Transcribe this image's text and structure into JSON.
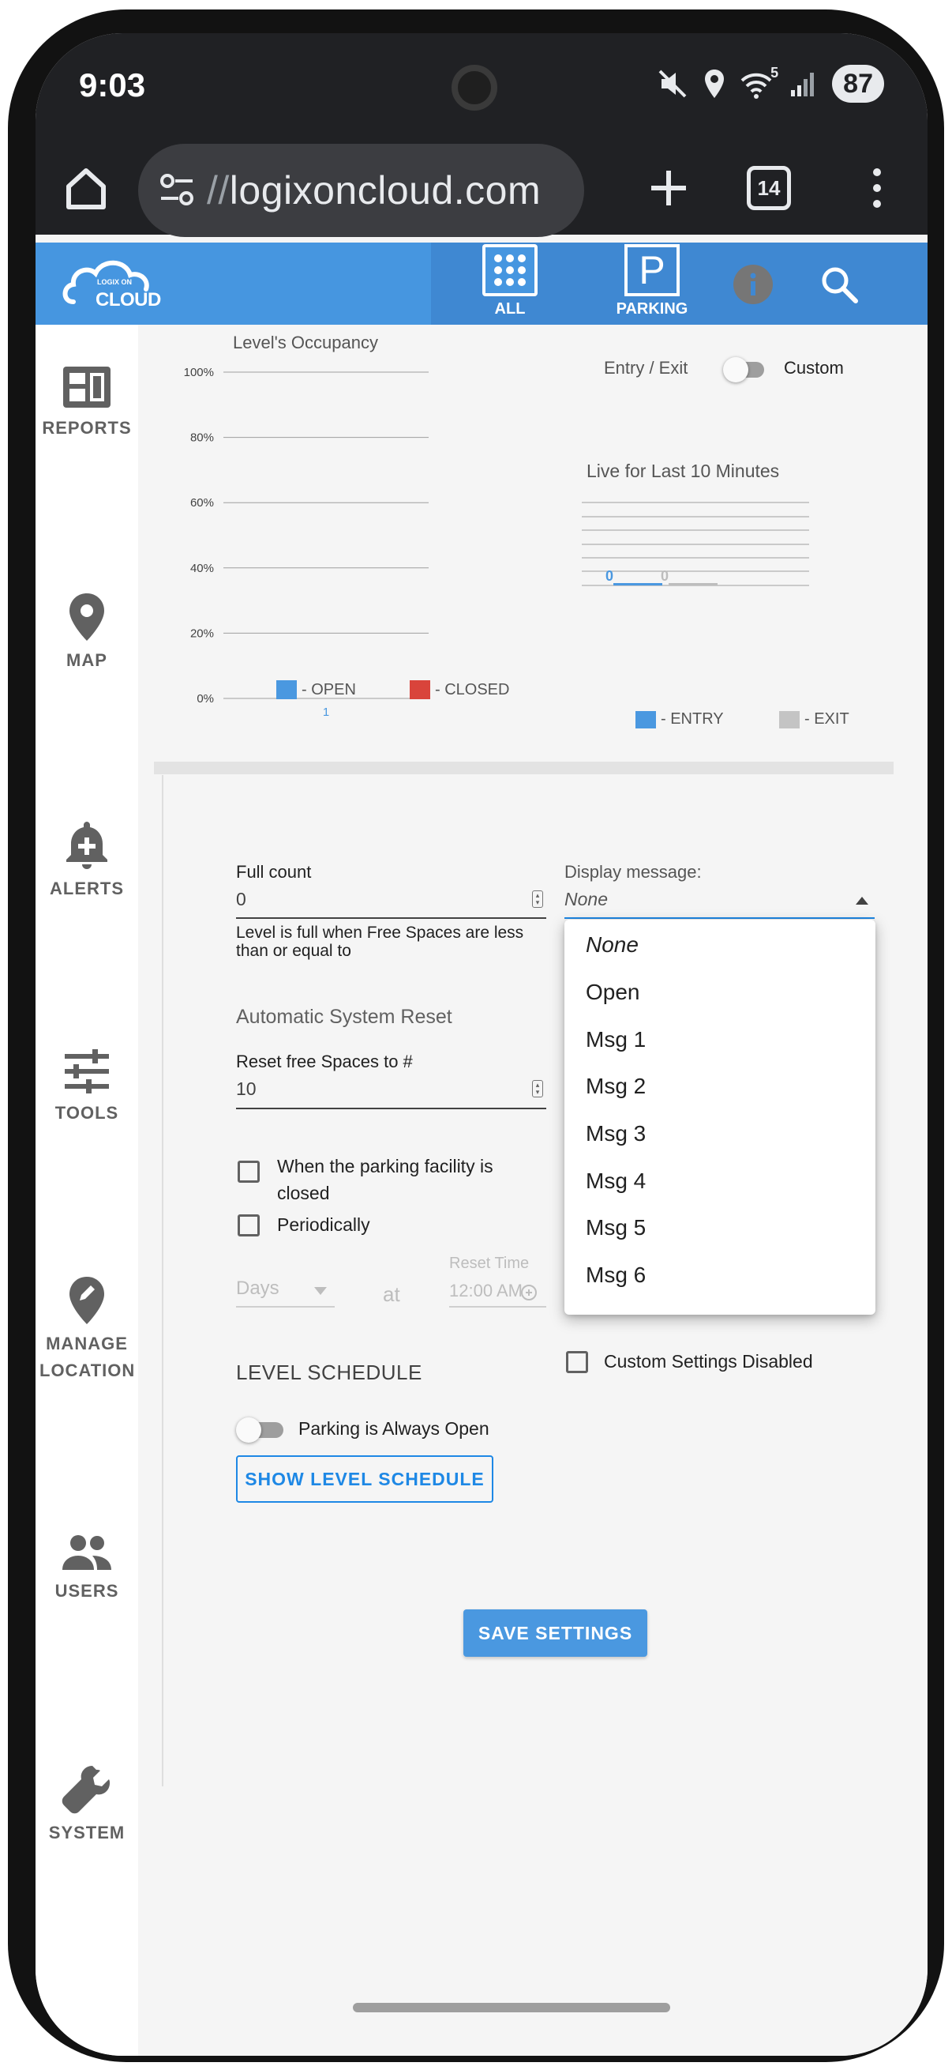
{
  "status_bar": {
    "time": "9:03",
    "battery": "87",
    "wifi_level": "5"
  },
  "browser": {
    "url_prefix": "//",
    "url_domain": "logixoncloud.com",
    "tab_count": "14"
  },
  "header": {
    "logo_small": "LOGIX ON",
    "logo_big": "CLOUD",
    "nav": [
      {
        "label": "ALL"
      },
      {
        "label": "PARKING"
      }
    ]
  },
  "sidebar": {
    "items": [
      {
        "label": "REPORTS"
      },
      {
        "label": "MAP"
      },
      {
        "label": "ALERTS"
      },
      {
        "label": "TOOLS"
      },
      {
        "label": "MANAGE LOCATION"
      },
      {
        "label": "USERS"
      },
      {
        "label": "SYSTEM"
      }
    ]
  },
  "occupancy": {
    "title": "Level's Occupancy",
    "toggle_left": "Entry / Exit",
    "toggle_right": "Custom",
    "legend_open": "- OPEN",
    "legend_closed": "- CLOSED"
  },
  "live": {
    "title": "Live for Last 10 Minutes",
    "legend_entry": "- ENTRY",
    "legend_exit": "- EXIT"
  },
  "chart_data": [
    {
      "type": "bar",
      "title": "Level's Occupancy",
      "categories": [
        "1"
      ],
      "series": [
        {
          "name": "OPEN",
          "values": [
            0
          ]
        },
        {
          "name": "CLOSED",
          "values": [
            0
          ]
        }
      ],
      "ylim": [
        0,
        100
      ],
      "y_ticks": [
        "0%",
        "20%",
        "40%",
        "60%",
        "80%",
        "100%"
      ],
      "grid": true,
      "legend": "bottom",
      "colors": {
        "OPEN": "#4a98e0",
        "CLOSED": "#d9443b"
      }
    },
    {
      "type": "bar",
      "title": "Live for Last 10 Minutes",
      "categories": [
        "ENTRY",
        "EXIT"
      ],
      "series": [
        {
          "name": "ENTRY",
          "values": [
            0
          ]
        },
        {
          "name": "EXIT",
          "values": [
            0
          ]
        }
      ],
      "data_labels": [
        "0",
        "0"
      ],
      "grid": true,
      "legend": "bottom",
      "colors": {
        "ENTRY": "#4a98e0",
        "EXIT": "#bdbdbd"
      }
    }
  ],
  "form": {
    "full_count_label": "Full count",
    "full_count_value": "0",
    "full_count_help": "Level is full when Free Spaces are less than or equal to",
    "display_message_label": "Display message:",
    "display_message_value": "None",
    "auto_reset_heading": "Automatic System Reset",
    "reset_label": "Reset free Spaces to #",
    "reset_value": "10",
    "check_closed_label": "When the parking facility is closed",
    "check_periodically_label": "Periodically",
    "days_placeholder": "Days",
    "at_label": "at",
    "reset_time_label": "Reset Time",
    "reset_time_value": "12:00 AM",
    "custom_settings_label": "Custom Settings Disabled",
    "level_schedule_heading": "LEVEL SCHEDULE",
    "always_open_label": "Parking is Always Open",
    "show_schedule_button": "SHOW LEVEL SCHEDULE",
    "save_button": "SAVE SETTINGS"
  },
  "dropdown": {
    "options": [
      "None",
      "Open",
      "Msg 1",
      "Msg 2",
      "Msg 3",
      "Msg 4",
      "Msg 5",
      "Msg 6"
    ]
  }
}
